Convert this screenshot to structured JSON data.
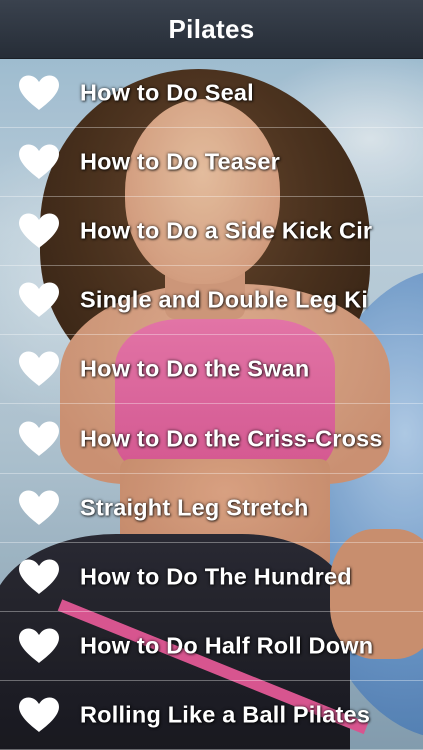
{
  "header": {
    "title": "Pilates"
  },
  "list": {
    "items": [
      {
        "label": "How to Do Seal",
        "icon": "heart-icon"
      },
      {
        "label": "How to Do Teaser",
        "icon": "heart-icon"
      },
      {
        "label": "How to Do a Side Kick Cir",
        "icon": "heart-icon"
      },
      {
        "label": "Single and Double Leg Ki",
        "icon": "heart-icon"
      },
      {
        "label": "How to Do the Swan",
        "icon": "heart-icon"
      },
      {
        "label": "How to Do the Criss-Cross",
        "icon": "heart-icon"
      },
      {
        "label": "Straight Leg Stretch",
        "icon": "heart-icon"
      },
      {
        "label": "How to Do The Hundred",
        "icon": "heart-icon"
      },
      {
        "label": "How to Do Half Roll Down",
        "icon": "heart-icon"
      },
      {
        "label": "Rolling Like a Ball Pilates",
        "icon": "heart-icon"
      }
    ]
  },
  "colors": {
    "nav_bar": "#2c3440",
    "label_text": "#ffffff",
    "heart_fill": "#ffffff",
    "separator": "#ffffff"
  }
}
